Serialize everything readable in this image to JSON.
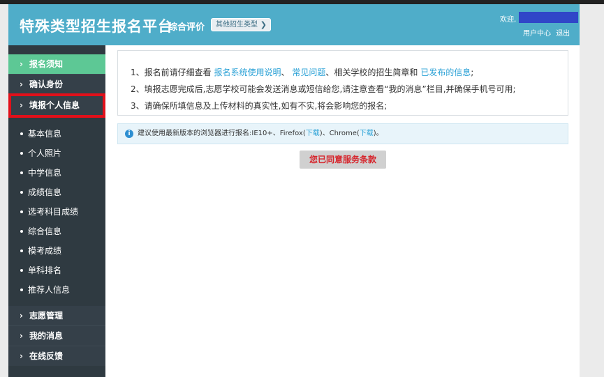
{
  "header": {
    "brand": "特殊类型招生报名平台",
    "subtitle": "综合评价",
    "other_types_button": "其他招生类型",
    "welcome": "欢迎,",
    "user_center": "用户中心",
    "logout": "退出"
  },
  "sidebar": {
    "items": [
      {
        "label": "报名须知"
      },
      {
        "label": "确认身份"
      },
      {
        "label": "填报个人信息"
      }
    ],
    "sub_items": [
      "基本信息",
      "个人照片",
      "中学信息",
      "成绩信息",
      "选考科目成绩",
      "综合信息",
      "模考成绩",
      "单科排名",
      "推荐人信息"
    ],
    "bottom_items": [
      {
        "label": "志愿管理"
      },
      {
        "label": "我的消息"
      },
      {
        "label": "在线反馈"
      }
    ]
  },
  "notice": {
    "line1_prefix": "1、报名前请仔细查看",
    "line1_link1": "报名系统使用说明",
    "line1_sep1": "、",
    "line1_link2": "常见问题",
    "line1_mid": "、相关学校的招生简章和",
    "line1_link3": "已发布的信息",
    "line1_suffix": ";",
    "line2": "2、填报志愿完成后,志愿学校可能会发送消息或短信给您,请注意查看“我的消息”栏目,并确保手机号可用;",
    "line3": "3、请确保所填信息及上传材料的真实性,如有不实,将会影响您的报名;"
  },
  "tip": {
    "text_prefix": "建议使用最新版本的浏览器进行报名:IE10+、Firefox(",
    "download1": "下载",
    "text_mid": ")、Chrome(",
    "download2": "下载",
    "text_suffix": ")。"
  },
  "agree_button": "您已同意服务条款",
  "colors": {
    "header_bg": "#4fadc9",
    "sidebar_bg": "#2f3a41",
    "active_item": "#5dc895",
    "highlight_border": "#e1101a",
    "link": "#2aa1d6",
    "agree_text": "#d6242b"
  }
}
